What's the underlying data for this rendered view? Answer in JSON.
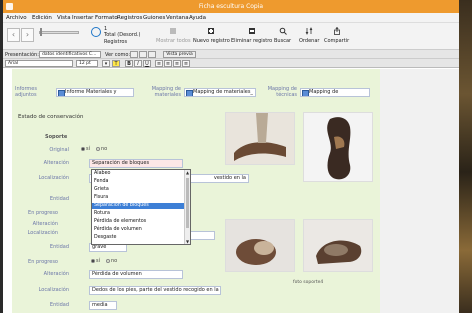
{
  "window": {
    "title": "Ficha escultura Copia"
  },
  "menu": [
    "Archivo",
    "Edición",
    "Vista",
    "Insertar",
    "Formato",
    "Registros",
    "Guiones",
    "Ventana",
    "Ayuda"
  ],
  "toolbar": {
    "record_number": "1",
    "total_label": "Total (Desord.)",
    "registros_label": "Registros",
    "show_all": "Mostrar todos",
    "new_record": "Nuevo registro",
    "delete_record": "Eliminar registro",
    "find": "Buscar",
    "sort": "Ordenar",
    "share": "Compartir"
  },
  "layoutbar": {
    "presentacion_label": "Presentación:",
    "presentacion_value": "datos identificativos C...",
    "ver_como_label": "Ver como:",
    "vista_previa": "Vista previa"
  },
  "formatbar": {
    "font": "Arial",
    "size": "12 pt",
    "bold": "B",
    "italic": "I",
    "underline": "U",
    "color_letter": "T"
  },
  "form": {
    "informes_label": "Informes adjuntos",
    "informes_value": "Informe Materiales y",
    "mapping_materiales_label": "Mapping de materiales",
    "mapping_materiales_value": "Mapping de materiales_",
    "mapping_tecnicas_label": "Mapping de técnicas",
    "mapping_tecnicas_value": "Mapping de",
    "estado_title": "Estado de conservación",
    "soporte_title": "Soporte",
    "original_label": "Original",
    "si": "sí",
    "no": "no",
    "alteracion_label": "Alteración",
    "alteracion_value": "Separación de bloques",
    "localizacion_label": "Localización",
    "localizacion_partial": "vestido en la",
    "entidad_label": "Entidad",
    "en_progreso_label": "En progreso",
    "alteracion2_label": "Alteración",
    "localizacion2_label": "Localización",
    "entidad2_label": "Entidad",
    "entidad2_value": "grave",
    "en_progreso2_label": "En progreso",
    "alteracion3_label": "Alteración",
    "alteracion3_value": "Pérdida de volumen",
    "localizacion3_label": "Localización",
    "localizacion3_value": "Dedos de los pies, parte del vestido recogido en la",
    "entidad3_label": "Entidad",
    "entidad3_value": "media",
    "photo_caption": "foto soporte4"
  },
  "dropdown": {
    "options": [
      "Alabeo",
      "Fenda",
      "Grieta",
      "Fisura",
      "Separación de bloques",
      "Rotura",
      "Pérdida de elementos",
      "Pérdida de volumen",
      "Desgaste"
    ],
    "selected": "Separación de bloques"
  }
}
